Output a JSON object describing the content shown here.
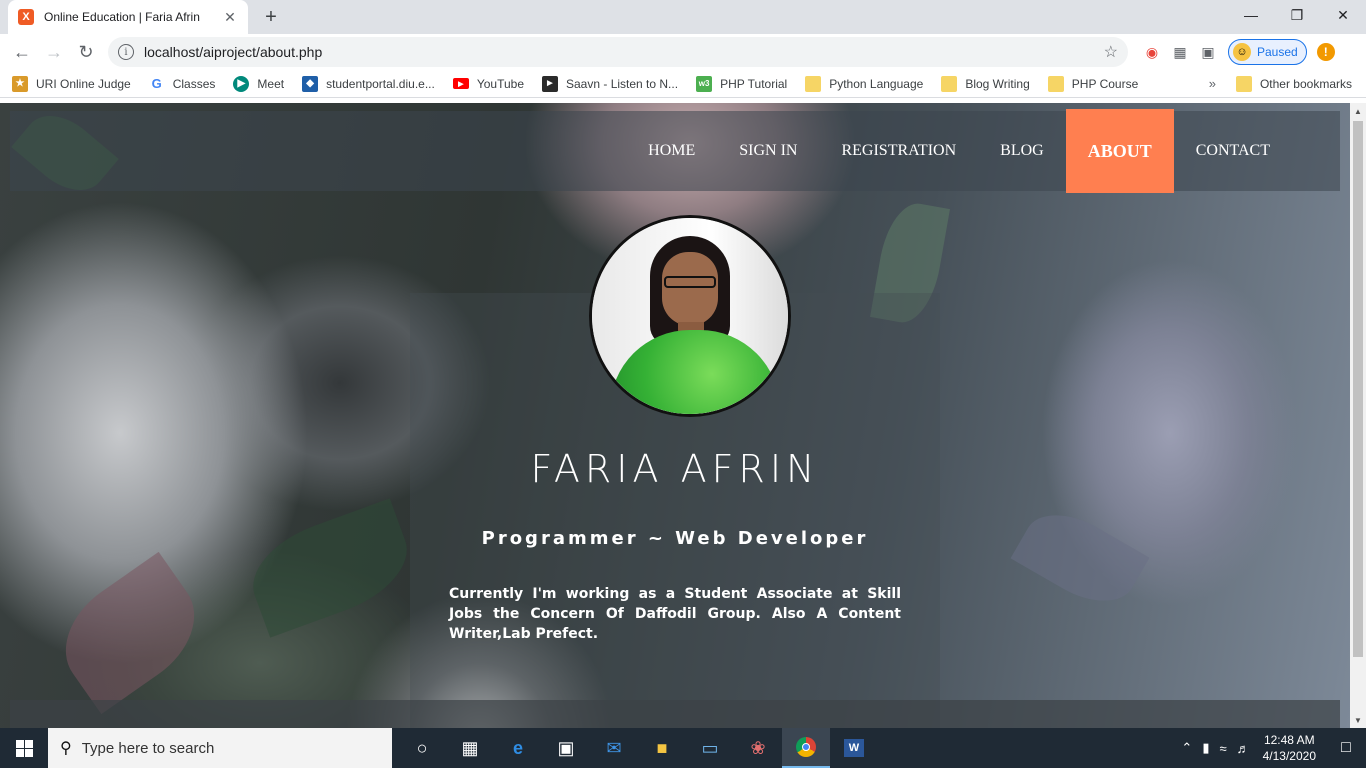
{
  "browser": {
    "tab_title": "Online Education | Faria Afrin",
    "tab_favicon": "X",
    "url": "localhost/aiproject/about.php",
    "profile_status": "Paused",
    "bookmarks": [
      {
        "label": "URI Online Judge",
        "icon": "trophy-icon",
        "color": "#d99a2b"
      },
      {
        "label": "Classes",
        "icon": "google-icon",
        "color": "#4285f4"
      },
      {
        "label": "Meet",
        "icon": "meet-icon",
        "color": "#00897b"
      },
      {
        "label": "studentportal.diu.e...",
        "icon": "portal-icon",
        "color": "#1f5fa8"
      },
      {
        "label": "YouTube",
        "icon": "youtube-icon",
        "color": "#ff0000"
      },
      {
        "label": "Saavn - Listen to N...",
        "icon": "saavn-icon",
        "color": "#2b2b2b"
      },
      {
        "label": "PHP Tutorial",
        "icon": "w3-icon",
        "color": "#4caf50"
      },
      {
        "label": "Python Language",
        "icon": "folder-icon",
        "color": "#f6d565"
      },
      {
        "label": "Blog Writing",
        "icon": "folder-icon",
        "color": "#f6d565"
      },
      {
        "label": "PHP Course",
        "icon": "folder-icon",
        "color": "#f6d565"
      }
    ],
    "bookmarks_more": "»",
    "other_bookmarks": "Other bookmarks"
  },
  "site": {
    "nav": [
      {
        "label": "HOME",
        "active": false
      },
      {
        "label": "SIGN IN",
        "active": false
      },
      {
        "label": "REGISTRATION",
        "active": false
      },
      {
        "label": "BLOG",
        "active": false
      },
      {
        "label": "ABOUT",
        "active": true
      },
      {
        "label": "CONTACT",
        "active": false
      }
    ],
    "accent_color": "#ff7f50",
    "name": "FARIA AFRIN",
    "role": "Programmer ~ Web Developer",
    "bio": "Currently I'm working as a Student Associate at Skill Jobs the Concern Of Daffodil Group. Also A Content Writer,Lab Prefect."
  },
  "taskbar": {
    "search_placeholder": "Type here to search",
    "time": "12:48 AM",
    "date": "4/13/2020"
  }
}
